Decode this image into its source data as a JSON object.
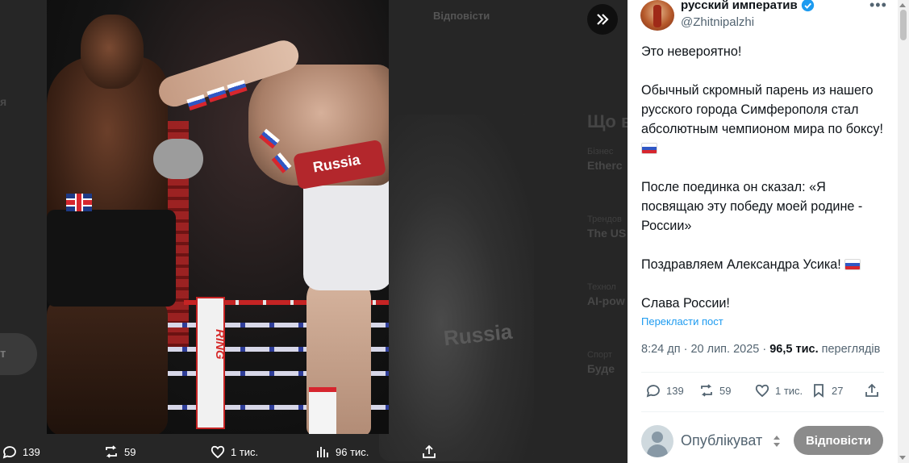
{
  "background_labels": {
    "reply_header": "Відповісти",
    "left_pill": "т",
    "left_edge": "я",
    "photo_ghost_text": "Russia",
    "right_column": {
      "title": "Що в",
      "rows": [
        {
          "top": "Бізнес",
          "bold": "Etherc"
        },
        {
          "top": "Трендов",
          "bold": "The US"
        },
        {
          "top": "Технол",
          "bold": "AI-pow"
        },
        {
          "top": "Спорт",
          "bold": "Буде"
        }
      ]
    }
  },
  "photo": {
    "belt_text": "Russia",
    "ring_logo": "RING"
  },
  "media_actions": {
    "replies": "139",
    "reposts": "59",
    "likes": "1 тис.",
    "views": "96 тис."
  },
  "tweet": {
    "display_name": "русский императив",
    "handle": "@Zhitnipalzhi",
    "paragraphs": {
      "p1": "Это невероятно!",
      "p2": "Обычный скромный парень из нашего русского города Симферополя стал абсолютным чемпионом мира по боксу!",
      "p3": "После поединка он сказал: «Я посвящаю эту победу моей родине - России»",
      "p4": "Поздравляем Александра Усика!",
      "p5": "Слава России!"
    },
    "translate_label": "Перекласти пост",
    "time": "8:24 дп",
    "sep": " · ",
    "date": "20 лип. 2025",
    "views_count": "96,5 тис.",
    "views_label": "переглядів",
    "stats": {
      "replies": "139",
      "reposts": "59",
      "likes": "1 тис.",
      "bookmarks": "27"
    }
  },
  "reply_box": {
    "placeholder": "Опублікуват",
    "button_label": "Відповісти"
  },
  "colors": {
    "accent_link": "#1d9bf0",
    "verified": "#1d9bf0",
    "reply_button": "#8b8b8b"
  }
}
